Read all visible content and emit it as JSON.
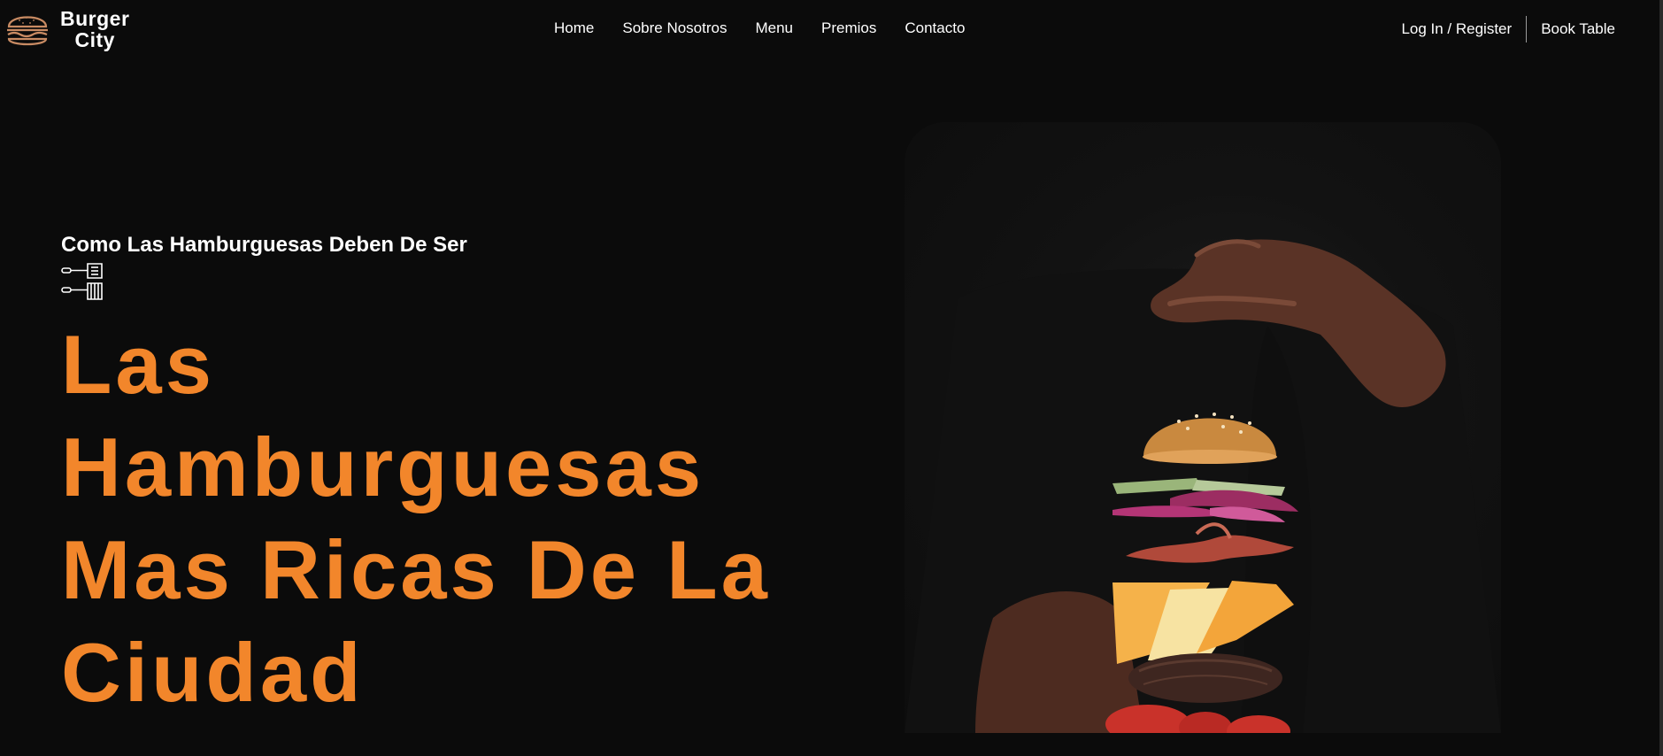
{
  "brand": {
    "line1": "Burger",
    "line2": "City"
  },
  "nav": {
    "items": [
      {
        "label": "Home"
      },
      {
        "label": "Sobre Nosotros"
      },
      {
        "label": "Menu"
      },
      {
        "label": "Premios"
      },
      {
        "label": "Contacto"
      }
    ]
  },
  "actions": {
    "login_label": "Log In / Register",
    "book_label": "Book Table"
  },
  "hero": {
    "tagline": "Como Las Hamburguesas Deben De Ser",
    "title_lines": [
      "Las",
      "Hamburguesas",
      "Mas Ricas De La",
      "Ciudad"
    ],
    "tools_icon": "spatula-icon"
  },
  "colors": {
    "background": "#0b0b0b",
    "accent": "#f2862b",
    "text": "#ffffff"
  }
}
